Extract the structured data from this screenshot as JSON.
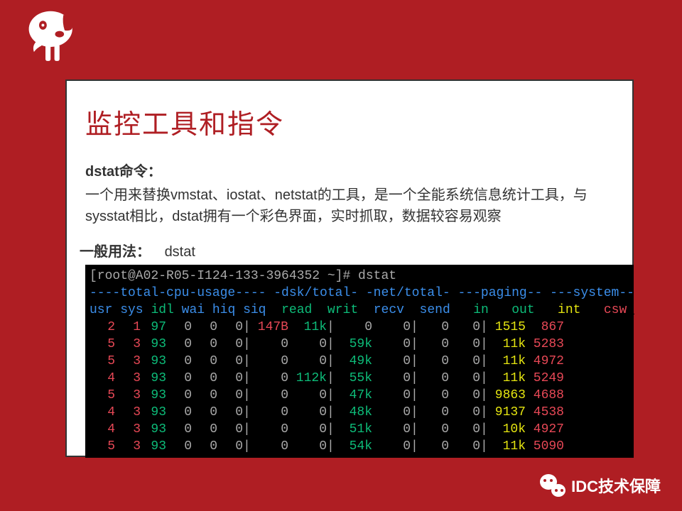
{
  "slide": {
    "title": "监控工具和指令",
    "command_label": "dstat命令：",
    "description": "一个用来替换vmstat、iostat、netstat的工具，是一个全能系统信息统计工具，与sysstat相比，dstat拥有一个彩色界面，实时抓取，数据较容易观察",
    "usage_label": "一般用法：",
    "usage_value": "dstat"
  },
  "terminal": {
    "prompt": "[root@A02-R05-I124-133-3964352 ~]# dstat",
    "header": "----total-cpu-usage---- -dsk/total- -net/total- ---paging-- ---system--",
    "columns": "usr sys idl wai hiq siq| read  writ| recv  send|  in   out | int   csw ",
    "rows": [
      {
        "usr": "2",
        "sys": "1",
        "idl": "97",
        "wai": "0",
        "hiq": "0",
        "siq": "0",
        "read": "147B",
        "writ": "11k",
        "recv": "0",
        "send": "0",
        "in": "0",
        "out": "0",
        "int": "1515",
        "csw": "867"
      },
      {
        "usr": "5",
        "sys": "3",
        "idl": "93",
        "wai": "0",
        "hiq": "0",
        "siq": "0",
        "read": "0",
        "writ": "0",
        "recv": "59k",
        "send": "0",
        "in": "0",
        "out": "0",
        "int": "11k",
        "csw": "5283"
      },
      {
        "usr": "5",
        "sys": "3",
        "idl": "93",
        "wai": "0",
        "hiq": "0",
        "siq": "0",
        "read": "0",
        "writ": "0",
        "recv": "49k",
        "send": "0",
        "in": "0",
        "out": "0",
        "int": "11k",
        "csw": "4972"
      },
      {
        "usr": "4",
        "sys": "3",
        "idl": "93",
        "wai": "0",
        "hiq": "0",
        "siq": "0",
        "read": "0",
        "writ": "112k",
        "recv": "55k",
        "send": "0",
        "in": "0",
        "out": "0",
        "int": "11k",
        "csw": "5249"
      },
      {
        "usr": "5",
        "sys": "3",
        "idl": "93",
        "wai": "0",
        "hiq": "0",
        "siq": "0",
        "read": "0",
        "writ": "0",
        "recv": "47k",
        "send": "0",
        "in": "0",
        "out": "0",
        "int": "9863",
        "csw": "4688"
      },
      {
        "usr": "4",
        "sys": "3",
        "idl": "93",
        "wai": "0",
        "hiq": "0",
        "siq": "0",
        "read": "0",
        "writ": "0",
        "recv": "48k",
        "send": "0",
        "in": "0",
        "out": "0",
        "int": "9137",
        "csw": "4538"
      },
      {
        "usr": "4",
        "sys": "3",
        "idl": "93",
        "wai": "0",
        "hiq": "0",
        "siq": "0",
        "read": "0",
        "writ": "0",
        "recv": "51k",
        "send": "0",
        "in": "0",
        "out": "0",
        "int": "10k",
        "csw": "4927"
      },
      {
        "usr": "5",
        "sys": "3",
        "idl": "93",
        "wai": "0",
        "hiq": "0",
        "siq": "0",
        "read": "0",
        "writ": "0",
        "recv": "54k",
        "send": "0",
        "in": "0",
        "out": "0",
        "int": "11k",
        "csw": "5090"
      }
    ]
  },
  "footer": {
    "text": "IDC技术保障"
  }
}
